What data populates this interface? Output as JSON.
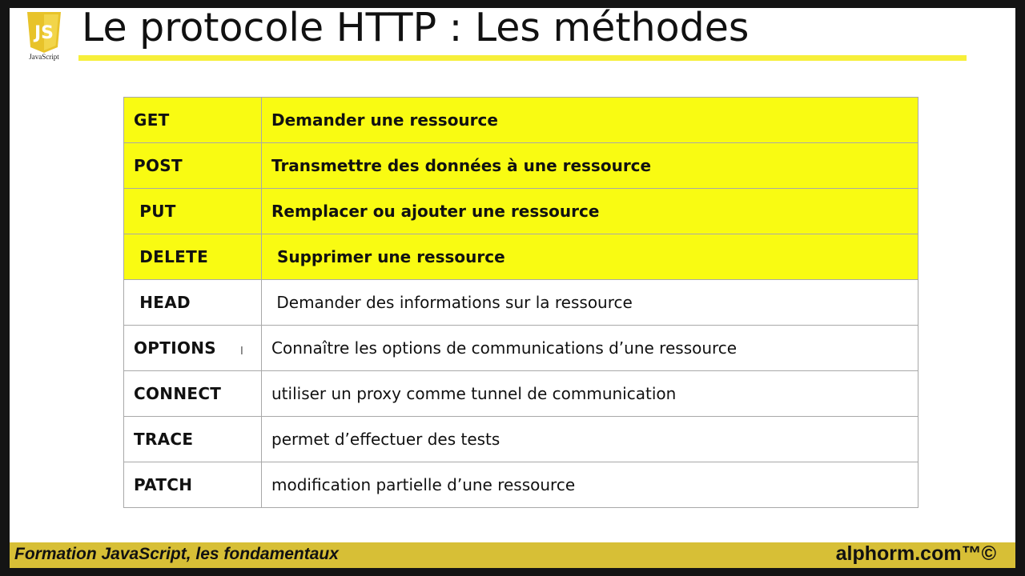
{
  "logo": {
    "icon": "javascript-shield-icon",
    "mark": "JS",
    "caption": "JavaScript",
    "color": "#e8c32a"
  },
  "title": "Le protocole HTTP : Les méthodes",
  "accent_color": "#f7ef3a",
  "highlight_color": "#f9fb12",
  "table": {
    "rows": [
      {
        "method": "GET",
        "description": "Demander une ressource",
        "highlighted": true
      },
      {
        "method": "POST",
        "description": "Transmettre des données à une ressource",
        "highlighted": true
      },
      {
        "method": " PUT",
        "description": "Remplacer ou ajouter une ressource",
        "highlighted": true
      },
      {
        "method": " DELETE",
        "description": " Supprimer une ressource",
        "highlighted": true
      },
      {
        "method": " HEAD",
        "description": " Demander des informations sur la ressource",
        "highlighted": false
      },
      {
        "method": "OPTIONS",
        "description": "Connaître les options de communications d’une ressource",
        "highlighted": false
      },
      {
        "method": "CONNECT",
        "description": "utiliser un proxy comme tunnel de communication",
        "highlighted": false
      },
      {
        "method": "TRACE",
        "description": "permet d’effectuer des tests",
        "highlighted": false
      },
      {
        "method": "PATCH",
        "description": "modification partielle d’une ressource",
        "highlighted": false
      }
    ]
  },
  "cursor_icon": "text-cursor-icon",
  "footer": {
    "course": "Formation JavaScript, les fondamentaux",
    "brand": "alphorm.com™©",
    "color": "#d7bf36"
  }
}
